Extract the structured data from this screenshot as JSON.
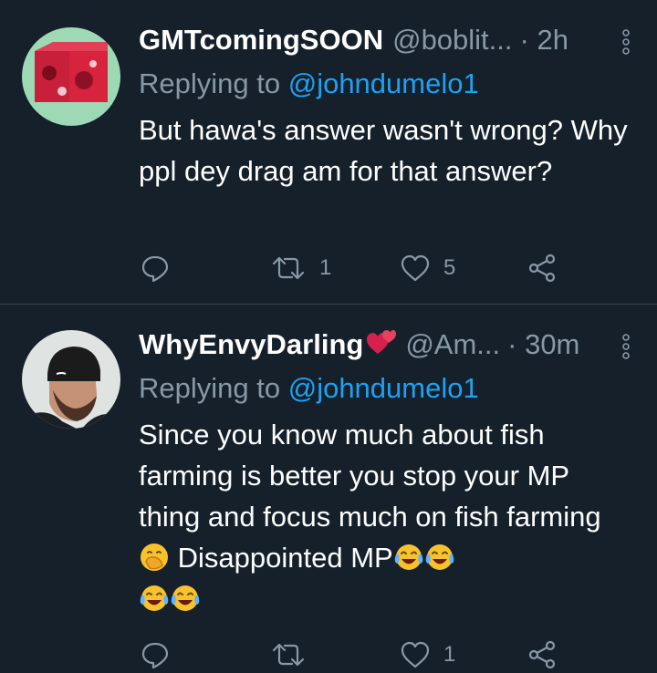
{
  "colors": {
    "background": "#15202b",
    "divider": "#38444d",
    "secondary_text": "#8899a6",
    "mention": "#1da1f2",
    "primary_text": "#ffffff"
  },
  "tweets": [
    {
      "display_name": "GMTcomingSOON",
      "handle": "@boblit...",
      "time": "· 2h",
      "replying_prefix": "Replying to",
      "replying_to": "@johndumelo1",
      "body": "But hawa's answer wasn't wrong? Why ppl dey drag am for that answer?",
      "reply_count": "",
      "retweet_count": "1",
      "like_count": "5"
    },
    {
      "display_name": "WhyEnvyDarling",
      "handle": "@Am...",
      "time": "· 30m",
      "replying_prefix": "Replying to",
      "replying_to": "@johndumelo1",
      "body_text_1": "Since you know much about fish farming is better you stop your MP thing and focus much on fish farming",
      "body_text_2": "Disappointed MP",
      "name_emoji": "two-hearts-emoji",
      "body_emojis": [
        "face-with-hand-over-mouth-emoji",
        "tears-of-joy-emoji",
        "tears-of-joy-emoji",
        "tears-of-joy-emoji",
        "tears-of-joy-emoji"
      ],
      "reply_count": "",
      "retweet_count": "",
      "like_count": "1"
    }
  ],
  "icons": {
    "reply": "reply-icon",
    "retweet": "retweet-icon",
    "like": "heart-icon",
    "share": "share-icon",
    "more": "more-vertical-icon"
  }
}
